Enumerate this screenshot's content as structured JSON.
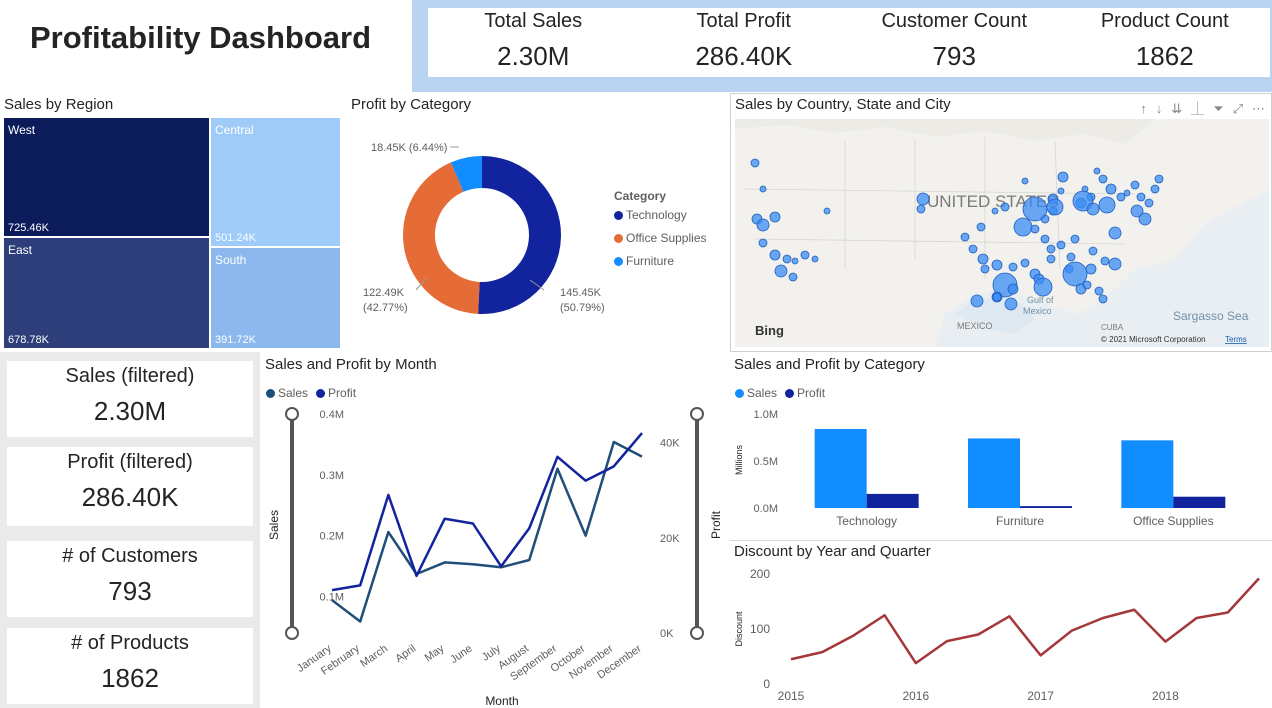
{
  "header": {
    "title": "Profitability Dashboard"
  },
  "kpis": [
    {
      "label": "Total Sales",
      "value": "2.30M"
    },
    {
      "label": "Total Profit",
      "value": "286.40K"
    },
    {
      "label": "Customer Count",
      "value": "793"
    },
    {
      "label": "Product Count",
      "value": "1862"
    }
  ],
  "side_cards": [
    {
      "label": "Sales (filtered)",
      "value": "2.30M"
    },
    {
      "label": "Profit (filtered)",
      "value": "286.40K"
    },
    {
      "label": "# of Customers",
      "value": "793"
    },
    {
      "label": "# of Products",
      "value": "1862"
    }
  ],
  "treemap": {
    "title": "Sales by Region",
    "cells": [
      {
        "name": "West",
        "value": "725.46K",
        "color": "#0c1c5a"
      },
      {
        "name": "Central",
        "value": "501.24K",
        "color": "#9ecbf8"
      },
      {
        "name": "East",
        "value": "678.78K",
        "color": "#2d3e7a"
      },
      {
        "name": "South",
        "value": "391.72K",
        "color": "#8cb8ed"
      }
    ]
  },
  "donut": {
    "title": "Profit by Category",
    "legend_title": "Category",
    "labels": {
      "furniture": "18.45K (6.44%)",
      "office_line1": "122.49K",
      "office_line2": "(42.77%)",
      "tech_line1": "145.45K",
      "tech_line2": "(50.79%)"
    },
    "colors": {
      "Technology": "#12239e",
      "Office Supplies": "#e66c37",
      "Furniture": "#118dff"
    }
  },
  "map": {
    "title": "Sales by Country, State and City",
    "labels": {
      "country": "UNITED STATES",
      "gulf_line1": "Gulf of",
      "gulf_line2": "Mexico",
      "mexico": "MEXICO",
      "cuba": "CUBA",
      "sea": "Sargasso Sea",
      "bing": "Bing",
      "copyright": "© 2021 Microsoft Corporation",
      "terms": "Terms"
    },
    "toolbar_icons": [
      "arrow-up-icon",
      "arrow-down-icon",
      "double-arrow-down-icon",
      "expand-hierarchy-icon",
      "filter-icon",
      "focus-mode-icon",
      "more-options-icon"
    ]
  },
  "chart_data": [
    {
      "type": "line",
      "title": "Sales and Profit by Month",
      "xlabel": "Month",
      "ylabel": "Sales",
      "y2label": "Profit",
      "categories": [
        "January",
        "February",
        "March",
        "April",
        "May",
        "June",
        "July",
        "August",
        "September",
        "October",
        "November",
        "December"
      ],
      "series": [
        {
          "name": "Sales",
          "axis": "left",
          "values": [
            94000,
            59000,
            206000,
            137000,
            156000,
            153000,
            148000,
            160000,
            310000,
            200000,
            354000,
            330000
          ],
          "color": "#1f4e79"
        },
        {
          "name": "Profit",
          "axis": "right",
          "values": [
            9000,
            10000,
            29000,
            12000,
            24000,
            23000,
            14000,
            22000,
            37000,
            32000,
            35000,
            42000
          ],
          "color": "#12239e"
        }
      ],
      "ylim": [
        40000,
        400000
      ],
      "yticks": [
        "0.1M",
        "0.2M",
        "0.3M",
        "0.4M"
      ],
      "y2lim": [
        0,
        46000
      ],
      "y2ticks": [
        "0K",
        "20K",
        "40K"
      ],
      "legend": "top-left"
    },
    {
      "type": "bar",
      "title": "Sales and Profit by Category",
      "ylabel": "Millions",
      "categories": [
        "Technology",
        "Furniture",
        "Office Supplies"
      ],
      "series": [
        {
          "name": "Sales",
          "values": [
            0.84,
            0.74,
            0.72
          ],
          "color": "#118dff"
        },
        {
          "name": "Profit",
          "values": [
            0.15,
            0.02,
            0.12
          ],
          "color": "#12239e"
        }
      ],
      "ylim": [
        0,
        1.0
      ],
      "yticks": [
        "0.0M",
        "0.5M",
        "1.0M"
      ],
      "legend": "top-left"
    },
    {
      "type": "line",
      "title": "Discount by Year and Quarter",
      "ylabel": "Discount",
      "x_ticks": [
        "2015",
        "2016",
        "2017",
        "2018"
      ],
      "series": [
        {
          "name": "Discount",
          "values": [
            45,
            58,
            88,
            125,
            38,
            78,
            90,
            123,
            52,
            97,
            120,
            135,
            77,
            120,
            130,
            192
          ],
          "color": "#a4373a"
        }
      ],
      "ylim": [
        0,
        200
      ],
      "yticks": [
        "0",
        "100",
        "200"
      ]
    },
    {
      "type": "pie",
      "title": "Profit by Category",
      "categories": [
        "Technology",
        "Office Supplies",
        "Furniture"
      ],
      "values": [
        145.45,
        122.49,
        18.45
      ],
      "percentages": [
        50.79,
        42.77,
        6.44
      ]
    }
  ]
}
